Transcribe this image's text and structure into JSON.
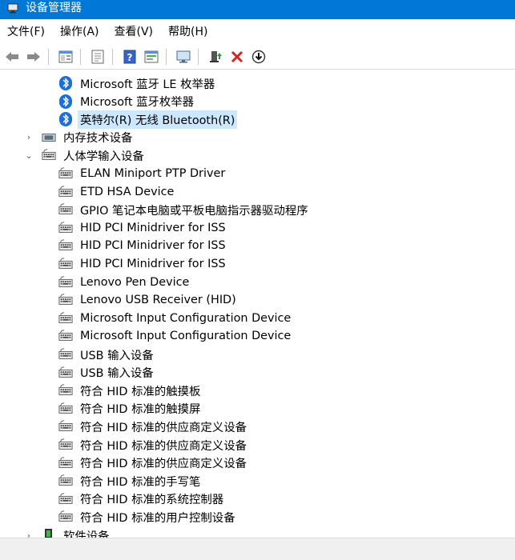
{
  "window": {
    "title": "设备管理器"
  },
  "menu": [
    "文件(F)",
    "操作(A)",
    "查看(V)",
    "帮助(H)"
  ],
  "toolbar": [
    "back-icon",
    "forward-icon",
    "properties-icon",
    "update-list-icon",
    "help-icon",
    "view-icon",
    "monitor-icon",
    "update-driver-icon",
    "uninstall-icon",
    "download-icon"
  ],
  "tree": {
    "bluetooth_children": [
      "Microsoft 蓝牙 LE 枚举器",
      "Microsoft 蓝牙枚举器",
      "英特尔(R) 无线 Bluetooth(R)"
    ],
    "memory_tech": "内存技术设备",
    "hid_category": "人体学输入设备",
    "hid_children": [
      "ELAN Miniport PTP Driver",
      "ETD HSA Device",
      "GPIO 笔记本电脑或平板电脑指示器驱动程序",
      "HID PCI Minidriver for ISS",
      "HID PCI Minidriver for ISS",
      "HID PCI Minidriver for ISS",
      "Lenovo Pen Device",
      "Lenovo USB Receiver (HID)",
      "Microsoft Input Configuration Device",
      "Microsoft Input Configuration Device",
      "USB 输入设备",
      "USB 输入设备",
      "符合 HID 标准的触摸板",
      "符合 HID 标准的触摸屏",
      "符合 HID 标准的供应商定义设备",
      "符合 HID 标准的供应商定义设备",
      "符合 HID 标准的供应商定义设备",
      "符合 HID 标准的手写笔",
      "符合 HID 标准的系统控制器",
      "符合 HID 标准的用户控制设备"
    ],
    "software_devices": "软件设备"
  },
  "colors": {
    "title_bar": "#0078d7",
    "selection": "#cce8ff"
  }
}
